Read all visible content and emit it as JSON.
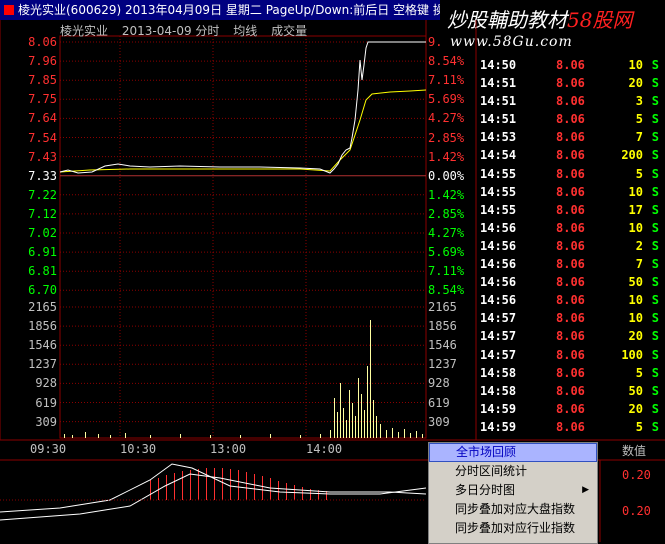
{
  "title_bar": {
    "text": "棱光实业(600629) 2013年04月09日 星期二 PageUp/Down:前后日 空格键 操作"
  },
  "watermark": {
    "title_a": "炒股輔助教材",
    "title_b": "58股网",
    "url": "www.58Gu.com"
  },
  "chart_header": {
    "stock": "棱光实业",
    "date": "2013-04-09 分时",
    "avg_label": "均线",
    "vol_label": "成交量"
  },
  "price_axis_left": [
    "8.06",
    "7.96",
    "7.85",
    "7.75",
    "7.64",
    "7.54",
    "7.43",
    "7.33",
    "7.22",
    "7.12",
    "7.02",
    "6.91",
    "6.81",
    "6.70"
  ],
  "price_axis_right": [
    "9.",
    "8.54%",
    "7.11%",
    "5.69%",
    "4.27%",
    "2.85%",
    "1.42%",
    "0.00%",
    "1.42%",
    "2.85%",
    "4.27%",
    "5.69%",
    "7.11%",
    "8.54%"
  ],
  "volume_axis": [
    "2165",
    "1856",
    "1546",
    "1237",
    "928",
    "619",
    "309"
  ],
  "time_axis": [
    "09:30",
    "10:30",
    "13:00",
    "14:00"
  ],
  "indicator_axis": [
    "0.20",
    "0.20"
  ],
  "colors": {
    "grid": "#8b0000",
    "up": "#ff3030",
    "down": "#00ff00",
    "neutral": "#ffffff",
    "volume": "#ffffa0",
    "avg_line": "#ffff00",
    "selection": "#aab4ff"
  },
  "ticks": [
    {
      "time": "14:50",
      "price": "8.06",
      "vol": "10",
      "side": "S"
    },
    {
      "time": "14:51",
      "price": "8.06",
      "vol": "20",
      "side": "S"
    },
    {
      "time": "14:51",
      "price": "8.06",
      "vol": "3",
      "side": "S"
    },
    {
      "time": "14:51",
      "price": "8.06",
      "vol": "5",
      "side": "S"
    },
    {
      "time": "14:53",
      "price": "8.06",
      "vol": "7",
      "side": "S"
    },
    {
      "time": "14:54",
      "price": "8.06",
      "vol": "200",
      "side": "S"
    },
    {
      "time": "14:55",
      "price": "8.06",
      "vol": "5",
      "side": "S"
    },
    {
      "time": "14:55",
      "price": "8.06",
      "vol": "10",
      "side": "S"
    },
    {
      "time": "14:55",
      "price": "8.06",
      "vol": "17",
      "side": "S"
    },
    {
      "time": "14:56",
      "price": "8.06",
      "vol": "10",
      "side": "S"
    },
    {
      "time": "14:56",
      "price": "8.06",
      "vol": "2",
      "side": "S"
    },
    {
      "time": "14:56",
      "price": "8.06",
      "vol": "7",
      "side": "S"
    },
    {
      "time": "14:56",
      "price": "8.06",
      "vol": "50",
      "side": "S"
    },
    {
      "time": "14:56",
      "price": "8.06",
      "vol": "10",
      "side": "S"
    },
    {
      "time": "14:57",
      "price": "8.06",
      "vol": "10",
      "side": "S"
    },
    {
      "time": "14:57",
      "price": "8.06",
      "vol": "20",
      "side": "S"
    },
    {
      "time": "14:57",
      "price": "8.06",
      "vol": "100",
      "side": "S"
    },
    {
      "time": "14:58",
      "price": "8.06",
      "vol": "5",
      "side": "S"
    },
    {
      "time": "14:58",
      "price": "8.06",
      "vol": "50",
      "side": "S"
    },
    {
      "time": "14:59",
      "price": "8.06",
      "vol": "20",
      "side": "S"
    },
    {
      "time": "14:59",
      "price": "8.06",
      "vol": "5",
      "side": "S"
    }
  ],
  "context_menu": [
    {
      "label": "全市场回顾",
      "selected": true,
      "submenu": false
    },
    {
      "label": "分时区间统计",
      "selected": false,
      "submenu": false
    },
    {
      "label": "多日分时图",
      "selected": false,
      "submenu": true
    },
    {
      "label": "同步叠加对应大盘指数",
      "selected": false,
      "submenu": false
    },
    {
      "label": "同步叠加对应行业指数",
      "selected": false,
      "submenu": false
    }
  ],
  "value_tab": "数值"
}
